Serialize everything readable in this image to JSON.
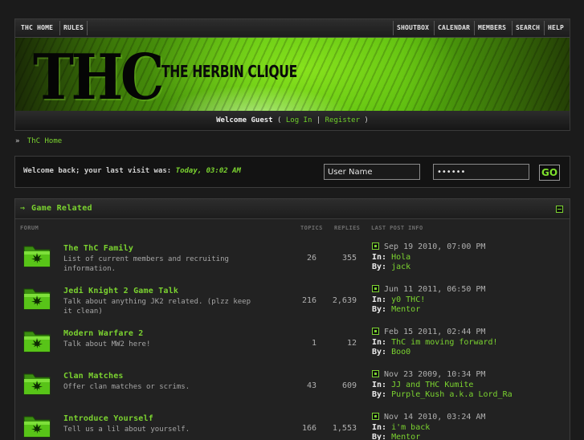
{
  "nav": {
    "left": [
      "THC HOME",
      "RULES"
    ],
    "right": [
      "SHOUTBOX",
      "CALENDAR",
      "MEMBERS",
      "SEARCH",
      "HELP"
    ]
  },
  "banner": {
    "logo": "THC",
    "tagline": "THE HERBIN CLIQUE"
  },
  "welcome": {
    "greeting": "Welcome Guest",
    "open": "(",
    "login": "Log In",
    "divider": "|",
    "register": "Register",
    "close": ")"
  },
  "breadcrumb": {
    "arrow": "»",
    "home": "ThC Home"
  },
  "login_box": {
    "message": "Welcome back; your last visit was:",
    "last_visit": "Today, 03:02 AM",
    "username_value": "User Name",
    "password_value": "••••••",
    "go_label": "GO"
  },
  "category": {
    "arrow": "⇒",
    "title": "Game Related",
    "columns": {
      "forum": "FORUM",
      "topics": "TOPICS",
      "replies": "REPLIES",
      "last_post": "LAST POST INFO"
    },
    "in_label": "In:",
    "by_label": "By:",
    "forums": [
      {
        "name": "The ThC Family",
        "desc": "List of current members and recruiting information.",
        "topics": "26",
        "replies": "355",
        "date": "Sep 19 2010, 07:00 PM",
        "in": "Hola",
        "by": "jack"
      },
      {
        "name": "Jedi Knight 2 Game Talk",
        "desc": "Talk about anything JK2 related. (plzz keep it clean)",
        "topics": "216",
        "replies": "2,639",
        "date": "Jun 11 2011, 06:50 PM",
        "in": "y0 THC!",
        "by": "Mentor"
      },
      {
        "name": "Modern Warfare 2",
        "desc": "Talk about MW2 here!",
        "topics": "1",
        "replies": "12",
        "date": "Feb 15 2011, 02:44 PM",
        "in": "ThC im moving forward!",
        "by": "Boo0"
      },
      {
        "name": "Clan Matches",
        "desc": "Offer clan matches or scrims.",
        "topics": "43",
        "replies": "609",
        "date": "Nov 23 2009, 10:34 PM",
        "in": "JJ and THC Kumite",
        "by": "Purple_Kush a.k.a Lord_Ra"
      },
      {
        "name": "Introduce Yourself",
        "desc": "Tell us a lil about yourself.",
        "topics": "166",
        "replies": "1,553",
        "date": "Nov 14 2010, 03:24 AM",
        "in": "i'm back",
        "by": "Mentor"
      }
    ]
  },
  "colors": {
    "accent": "#7bd330",
    "background": "#1b1b1b",
    "panel": "#222222"
  }
}
